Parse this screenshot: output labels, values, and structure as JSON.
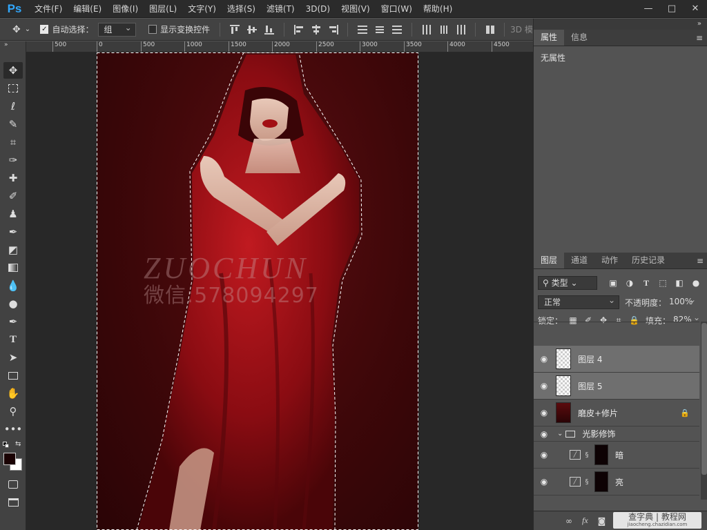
{
  "app": {
    "logo": "Ps",
    "menu": [
      "文件(F)",
      "编辑(E)",
      "图像(I)",
      "图层(L)",
      "文字(Y)",
      "选择(S)",
      "滤镜(T)",
      "3D(D)",
      "视图(V)",
      "窗口(W)",
      "帮助(H)"
    ],
    "window_controls": [
      "—",
      "□",
      "✕"
    ]
  },
  "options": {
    "auto_select_label": "自动选择：",
    "auto_select_value": "组",
    "show_transform_label": "显示变换控件",
    "right_text": "3D 模"
  },
  "ruler": {
    "ticks": [
      "500",
      "0",
      "500",
      "1000",
      "1500",
      "2000",
      "2500",
      "3000",
      "3500",
      "4000",
      "4500"
    ]
  },
  "properties_panel": {
    "tabs": [
      "属性",
      "信息"
    ],
    "body": "无属性",
    "collapse": "»"
  },
  "layers_panel": {
    "tabs": [
      "图层",
      "通道",
      "动作",
      "历史记录"
    ],
    "filter_label": "类型",
    "blend_mode": "正常",
    "opacity_label": "不透明度：",
    "opacity_value": "100%",
    "lock_label": "锁定：",
    "fill_label": "填充：",
    "fill_value": "82%",
    "layers": [
      {
        "name": "图层 4",
        "selected": true,
        "kind": "pixel"
      },
      {
        "name": "图层 5",
        "selected": true,
        "kind": "pixel"
      },
      {
        "name": "磨皮+修片",
        "selected": false,
        "kind": "photo",
        "locked": true
      },
      {
        "name": "光影修饰",
        "selected": false,
        "kind": "group"
      },
      {
        "name": "暗",
        "selected": false,
        "kind": "adjust"
      },
      {
        "name": "亮",
        "selected": false,
        "kind": "adjust"
      }
    ],
    "footer_icons": [
      "link-icon",
      "fx-icon",
      "mask-icon"
    ]
  },
  "photo_watermark": {
    "line1": "ZUOCHUN",
    "line2": "微信:578094297"
  },
  "site_watermark": {
    "line1": "查字典 | 教程网",
    "line2": "jiaocheng.chazidian.com"
  },
  "colors": {
    "accent": "#31a8ff",
    "backdrop_red": "#3d0709",
    "cloak_red": "#a8141a"
  }
}
